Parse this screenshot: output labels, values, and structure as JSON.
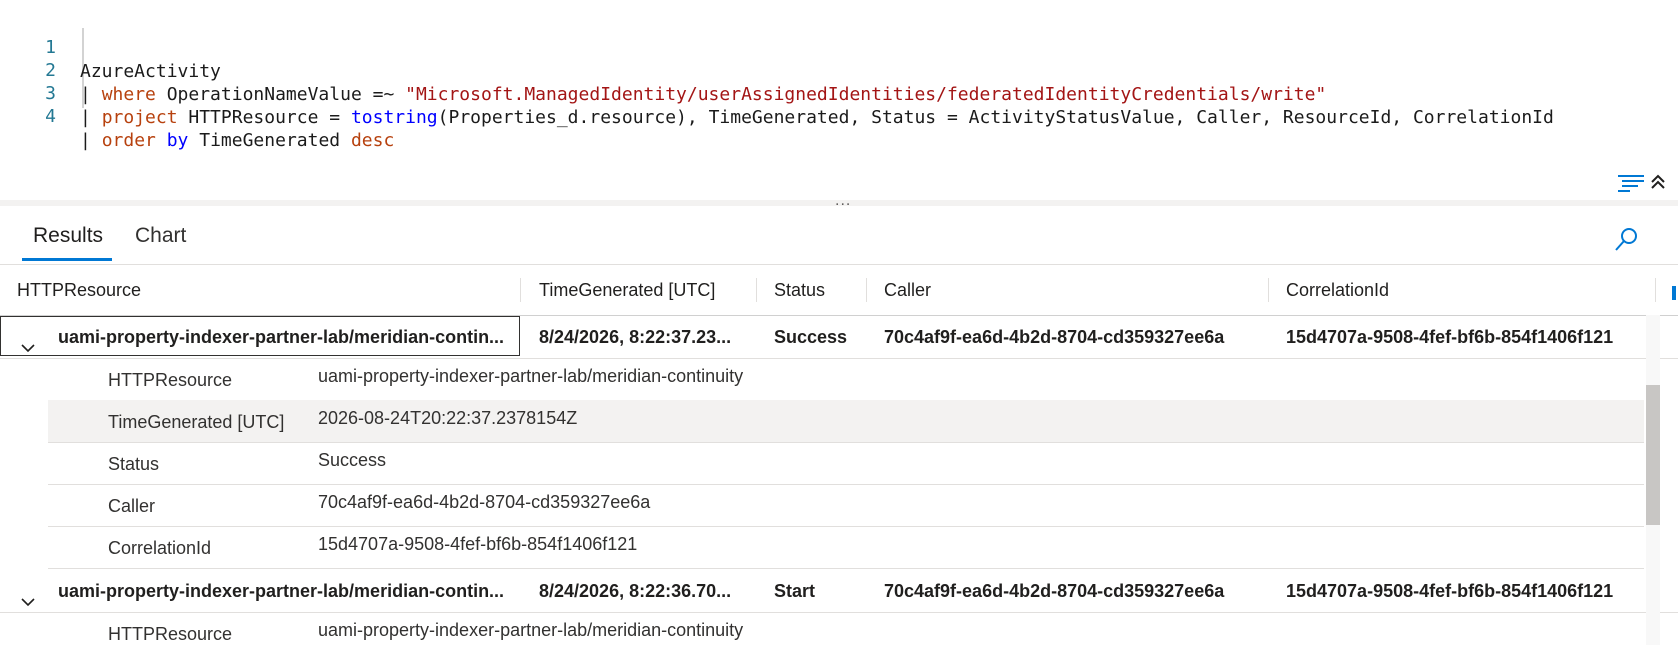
{
  "editor": {
    "lines": [
      {
        "num": "1",
        "text": "AzureActivity"
      },
      {
        "num": "2",
        "pipe": "| ",
        "kw": "where",
        "rest": " OperationNameValue =~ ",
        "str": "\"Microsoft.ManagedIdentity/userAssignedIdentities/federatedIdentityCredentials/write\""
      },
      {
        "num": "3",
        "pipe": "| ",
        "kw": "project",
        "a": " HTTPResource = ",
        "fn": "tostring",
        "b": "(Properties_d.resource), TimeGenerated, Status = ActivityStatusValue, Caller, ResourceId, CorrelationId"
      },
      {
        "num": "4",
        "pipe": "| ",
        "kw1": "order",
        "kw2": "by",
        "mid": " TimeGenerated ",
        "kw3": "desc"
      }
    ],
    "icons": [
      "format-icon",
      "collapse-up-icon"
    ]
  },
  "splitter": {
    "dots": "..."
  },
  "tabs": {
    "results": "Results",
    "chart": "Chart",
    "active": "Results",
    "search_icon": "search-icon"
  },
  "grid": {
    "headers": [
      "HTTPResource",
      "TimeGenerated [UTC]",
      "Status",
      "Caller",
      "CorrelationId"
    ],
    "rows": [
      {
        "http": "uami-property-indexer-partner-lab/meridian-contin...",
        "time": "8/24/2026, 8:22:37.23...",
        "status": "Success",
        "caller": "70c4af9f-ea6d-4b2d-8704-cd359327ee6a",
        "corr": "15d4707a-9508-4fef-bf6b-854f1406f121",
        "expanded": true,
        "details": [
          {
            "key": "HTTPResource",
            "value": "uami-property-indexer-partner-lab/meridian-continuity"
          },
          {
            "key": "TimeGenerated [UTC]",
            "value": "2026-08-24T20:22:37.2378154Z"
          },
          {
            "key": "Status",
            "value": "Success"
          },
          {
            "key": "Caller",
            "value": "70c4af9f-ea6d-4b2d-8704-cd359327ee6a"
          },
          {
            "key": "CorrelationId",
            "value": "15d4707a-9508-4fef-bf6b-854f1406f121"
          }
        ]
      },
      {
        "http": "uami-property-indexer-partner-lab/meridian-contin...",
        "time": "8/24/2026, 8:22:36.70...",
        "status": "Start",
        "caller": "70c4af9f-ea6d-4b2d-8704-cd359327ee6a",
        "corr": "15d4707a-9508-4fef-bf6b-854f1406f121",
        "expanded": true,
        "details": [
          {
            "key": "HTTPResource",
            "value": "uami-property-indexer-partner-lab/meridian-continuity"
          }
        ]
      }
    ]
  },
  "colors": {
    "accent": "#0078d4",
    "keyword_red": "#b7410e",
    "keyword_blue": "#0000ff",
    "string": "#a31515",
    "line_number": "#237893"
  }
}
